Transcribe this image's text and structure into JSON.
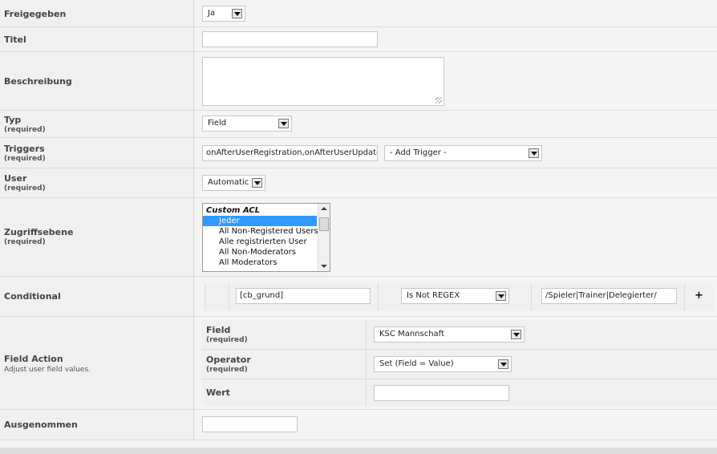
{
  "freigegeben": {
    "label": "Freigegeben",
    "value": "Ja"
  },
  "titel": {
    "label": "Titel",
    "value": ""
  },
  "beschreibung": {
    "label": "Beschreibung",
    "value": ""
  },
  "typ": {
    "label": "Typ",
    "required": "(required)",
    "value": "Field"
  },
  "triggers": {
    "label": "Triggers",
    "required": "(required)",
    "value": "onAfterUserRegistration,onAfterUserUpdate",
    "add_trigger": "- Add Trigger -"
  },
  "user": {
    "label": "User",
    "required": "(required)",
    "value": "Automatic"
  },
  "zugriffsebene": {
    "label": "Zugriffsebene",
    "required": "(required)",
    "group": "Custom ACL",
    "options": [
      "Jeder",
      "All Non-Registered Users",
      "Alle registrierten User",
      "All Non-Moderators",
      "All Moderators"
    ],
    "selected_index": 0
  },
  "conditional": {
    "label": "Conditional",
    "field": "[cb_grund]",
    "operator": "Is Not REGEX",
    "value": "/Spieler|Trainer|Delegierter/",
    "add_symbol": "+"
  },
  "field_action": {
    "label": "Field Action",
    "note": "Adjust user field values.",
    "field_label": "Field",
    "field_required": "(required)",
    "field_value": "KSC Mannschaft",
    "operator_label": "Operator",
    "operator_required": "(required)",
    "operator_value": "Set (Field = Value)",
    "wert_label": "Wert",
    "wert_value": ""
  },
  "ausgenommen": {
    "label": "Ausgenommen",
    "value": ""
  }
}
